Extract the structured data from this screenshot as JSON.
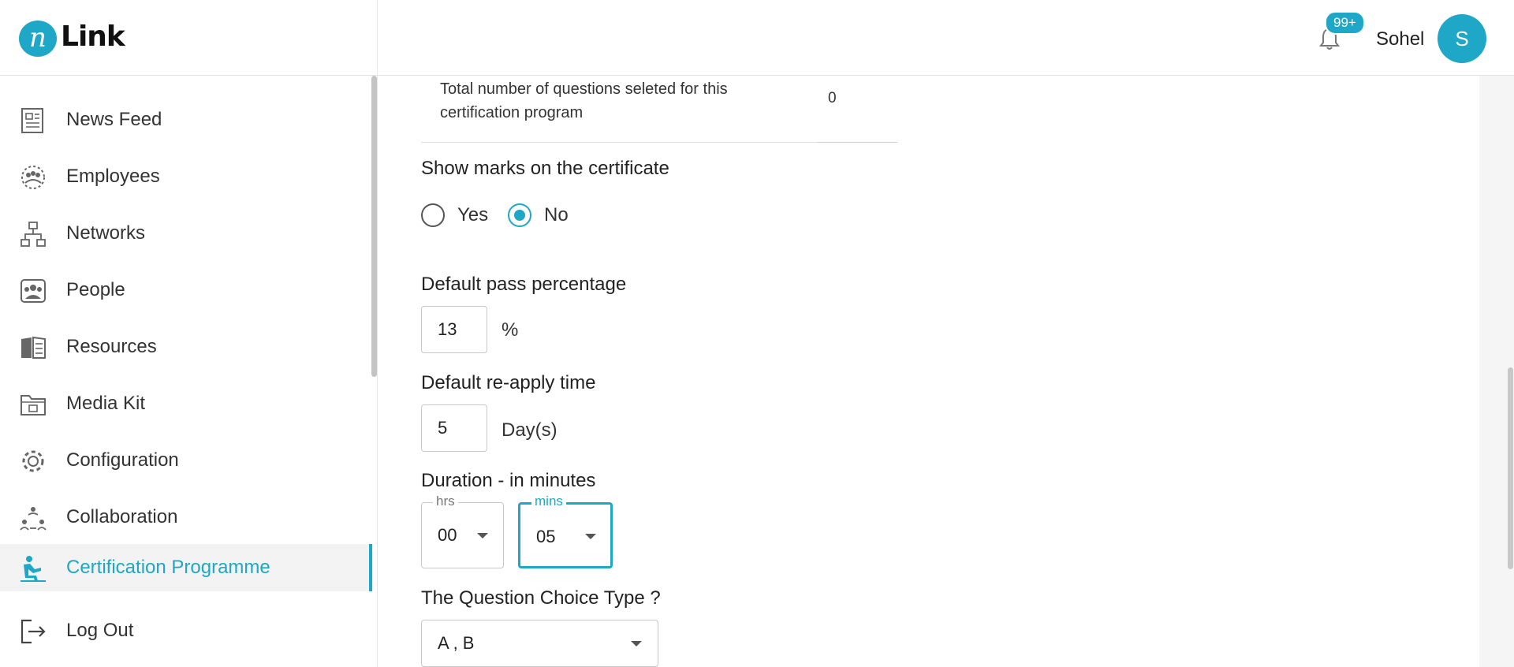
{
  "header": {
    "logo_mark": "n",
    "logo_text": "Link",
    "notification_badge": "99+",
    "user_name": "Sohel",
    "avatar_initial": "S",
    "brand_color": "#1ea7c7"
  },
  "sidebar": {
    "items": [
      {
        "label": "News Feed",
        "icon": "newspaper-icon"
      },
      {
        "label": "Employees",
        "icon": "employees-icon"
      },
      {
        "label": "Networks",
        "icon": "network-icon"
      },
      {
        "label": "People",
        "icon": "people-icon"
      },
      {
        "label": "Resources",
        "icon": "book-icon"
      },
      {
        "label": "Media Kit",
        "icon": "media-folder-icon"
      },
      {
        "label": "Configuration",
        "icon": "gear-icon"
      },
      {
        "label": "Collaboration",
        "icon": "collaboration-icon"
      },
      {
        "label": "Certification Programme",
        "icon": "certification-icon",
        "active": true
      },
      {
        "label": "Log Out",
        "icon": "logout-icon"
      }
    ]
  },
  "form": {
    "question_count_label": "Total number of questions seleted for this certification program",
    "question_count_value": "0",
    "show_marks_label": "Show marks on the certificate",
    "show_marks_options": [
      "Yes",
      "No"
    ],
    "show_marks_selected": "No",
    "pass_percentage_label": "Default pass percentage",
    "pass_percentage_value": "13",
    "pass_percentage_unit": "%",
    "reapply_label": "Default re-apply time",
    "reapply_value": "5",
    "reapply_unit": "Day(s)",
    "duration_label": "Duration - in minutes",
    "hours_legend": "hrs",
    "hours_value": "00",
    "minutes_legend": "mins",
    "minutes_value": "05",
    "choice_type_label": "The Question Choice Type ?",
    "choice_type_value": "A , B"
  }
}
